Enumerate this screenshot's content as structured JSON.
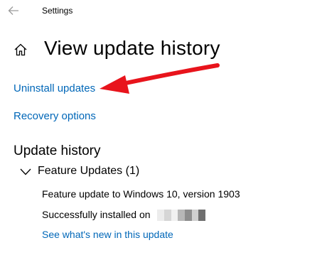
{
  "window": {
    "title": "Settings"
  },
  "page": {
    "title": "View update history"
  },
  "links": {
    "uninstall": "Uninstall updates",
    "recovery": "Recovery options",
    "whats_new": "See what's new in this update"
  },
  "history": {
    "section_title": "Update history",
    "group_label": "Feature Updates (1)",
    "item_name": "Feature update to Windows 10, version 1903",
    "item_status": "Successfully installed on"
  },
  "icons": {
    "back": "back-arrow-icon",
    "home": "home-icon",
    "chevron": "chevron-down-icon"
  },
  "colors": {
    "link": "#0067b8",
    "annotation_arrow": "#e8141c"
  }
}
